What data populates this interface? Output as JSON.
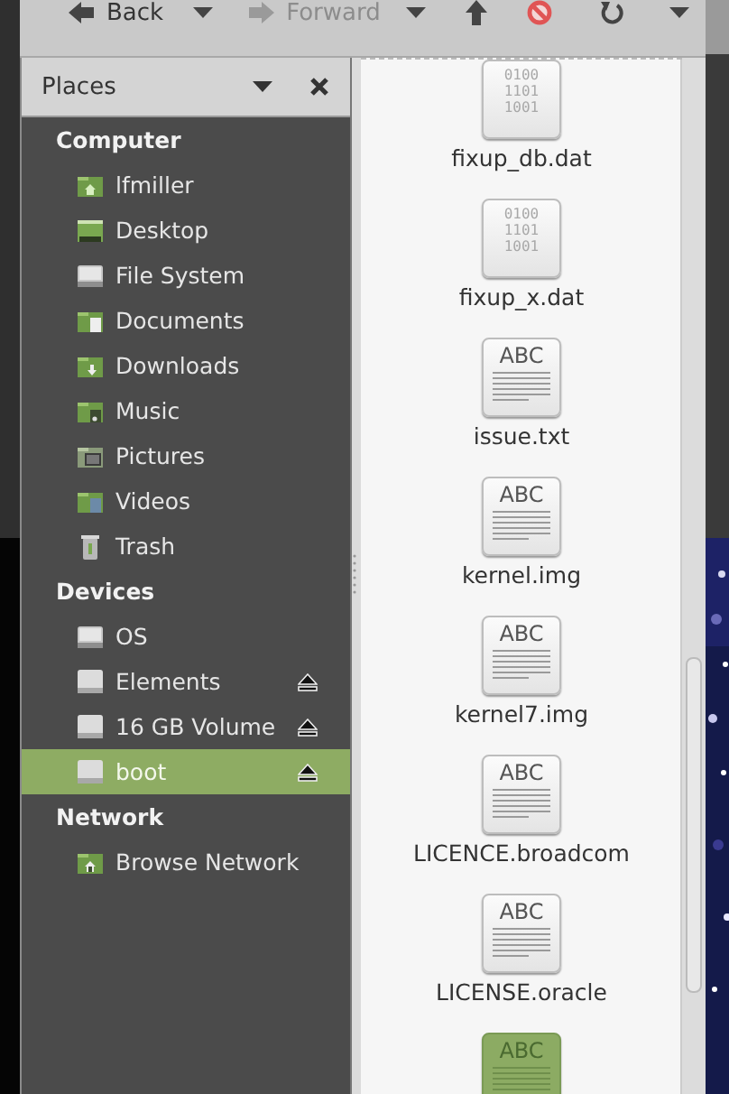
{
  "toolbar": {
    "buttons": [
      {
        "kind": "back",
        "label": "Back",
        "disabled": false
      },
      {
        "kind": "menu",
        "disabled": false
      },
      {
        "kind": "forward",
        "label": "Forward",
        "disabled": true
      },
      {
        "kind": "menu",
        "disabled": false
      },
      {
        "kind": "up",
        "disabled": false
      },
      {
        "kind": "stop",
        "disabled": false
      },
      {
        "kind": "reload",
        "disabled": false
      },
      {
        "kind": "menu",
        "disabled": false
      }
    ]
  },
  "sidebar": {
    "title": "Places",
    "sections": [
      {
        "title": "Computer",
        "items": [
          {
            "label": "lfmiller",
            "ejectable": false,
            "selected": false
          },
          {
            "label": "Desktop",
            "ejectable": false,
            "selected": false
          },
          {
            "label": "File System",
            "ejectable": false,
            "selected": false
          },
          {
            "label": "Documents",
            "ejectable": false,
            "selected": false
          },
          {
            "label": "Downloads",
            "ejectable": false,
            "selected": false
          },
          {
            "label": "Music",
            "ejectable": false,
            "selected": false
          },
          {
            "label": "Pictures",
            "ejectable": false,
            "selected": false
          },
          {
            "label": "Videos",
            "ejectable": false,
            "selected": false
          },
          {
            "label": "Trash",
            "ejectable": false,
            "selected": false
          }
        ]
      },
      {
        "title": "Devices",
        "items": [
          {
            "label": "OS",
            "ejectable": false,
            "selected": false
          },
          {
            "label": "Elements",
            "ejectable": true,
            "selected": false
          },
          {
            "label": "16 GB Volume",
            "ejectable": true,
            "selected": false
          },
          {
            "label": "boot",
            "ejectable": true,
            "selected": true
          }
        ]
      },
      {
        "title": "Network",
        "items": [
          {
            "label": "Browse Network",
            "ejectable": false,
            "selected": false
          }
        ]
      }
    ]
  },
  "files": [
    {
      "name": "fixup_db.dat",
      "kind": "binary",
      "icon_text": [
        "0100",
        "1101",
        "1001"
      ],
      "selected": false
    },
    {
      "name": "fixup_x.dat",
      "kind": "binary",
      "icon_text": [
        "0100",
        "1101",
        "1001"
      ],
      "selected": false
    },
    {
      "name": "issue.txt",
      "kind": "text",
      "icon_text": [
        "ABC"
      ],
      "selected": false
    },
    {
      "name": "kernel.img",
      "kind": "text",
      "icon_text": [
        "ABC"
      ],
      "selected": false
    },
    {
      "name": "kernel7.img",
      "kind": "text",
      "icon_text": [
        "ABC"
      ],
      "selected": false
    },
    {
      "name": "LICENCE.broadcom",
      "kind": "text",
      "icon_text": [
        "ABC"
      ],
      "selected": false
    },
    {
      "name": "LICENSE.oracle",
      "kind": "text",
      "icon_text": [
        "ABC"
      ],
      "selected": false
    },
    {
      "kind": "text",
      "icon_text": [
        "ABC"
      ],
      "selected": true
    }
  ]
}
